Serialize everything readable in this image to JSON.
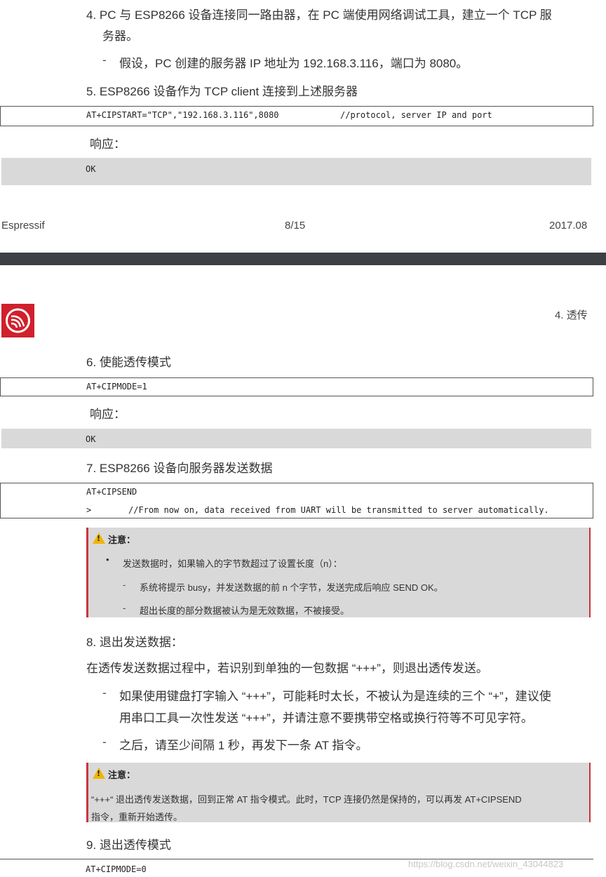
{
  "page1": {
    "step4_line1": "4. PC 与 ESP8266 设备连接同一路由器，在 PC 端使用网络调试工具，建立一个 TCP 服",
    "step4_line2": "务器。",
    "step4_sub": "假设，PC 创建的服务器 IP 地址为 192.168.3.116，端口为 8080。",
    "step5": "5. ESP8266 设备作为 TCP client 连接到上述服务器",
    "cmd5": "AT+CIPSTART=\"TCP\",\"192.168.3.116\",8080",
    "cmd5_comment": "//protocol, server IP and port",
    "response_label": "响应：",
    "response5": "OK",
    "footer_left": "Espressif",
    "footer_center": "8/15",
    "footer_right": "2017.08"
  },
  "page2": {
    "section": "4. 透传",
    "step6": "6. 使能透传模式",
    "cmd6": "AT+CIPMODE=1",
    "response_label": "响应：",
    "response6": "OK",
    "step7": "7. ESP8266 设备向服务器发送数据",
    "cmd7_line1": "AT+CIPSEND",
    "cmd7_prompt": ">",
    "cmd7_comment": "//From now on, data received from UART will be transmitted to server automatically.",
    "note1_title": "注意：",
    "note1_bullet": "发送数据时，如果输入的字节数超过了设置长度（n）：",
    "note1_sub1": "系统将提示 busy，并发送数据的前 n 个字节，发送完成后响应 SEND OK。",
    "note1_sub2": "超出长度的部分数据被认为是无效数据，不被接受。",
    "step8": "8. 退出发送数据：",
    "step8_desc": "在透传发送数据过程中，若识别到单独的一包数据 “+++”，则退出透传发送。",
    "step8_item1_line1": "如果使用键盘打字输入 “+++”，可能耗时太长，不被认为是连续的三个 “+”，建议使",
    "step8_item1_line2": "用串口工具一次性发送 “+++”，并请注意不要携带空格或换行符等不可见字符。",
    "step8_item2": "之后，请至少间隔 1 秒，再发下一条 AT 指令。",
    "note2_title": "注意：",
    "note2_line1": "“+++“ 退出透传发送数据，回到正常 AT 指令模式。此时，TCP 连接仍然是保持的，可以再发 AT+CIPSEND",
    "note2_line2": "指令，重新开始透传。",
    "step9": "9. 退出透传模式",
    "cmd9": "AT+CIPMODE=0"
  },
  "watermark": "https://blog.csdn.net/weixin_43044823",
  "colors": {
    "logo_red": "#d0202c",
    "note_border": "#c9353d",
    "gray_box": "#d9d9d9",
    "separator": "#3c3f43",
    "warning_yellow": "#f0b400"
  },
  "icons": [
    "espressif-logo-icon",
    "warning-icon"
  ]
}
